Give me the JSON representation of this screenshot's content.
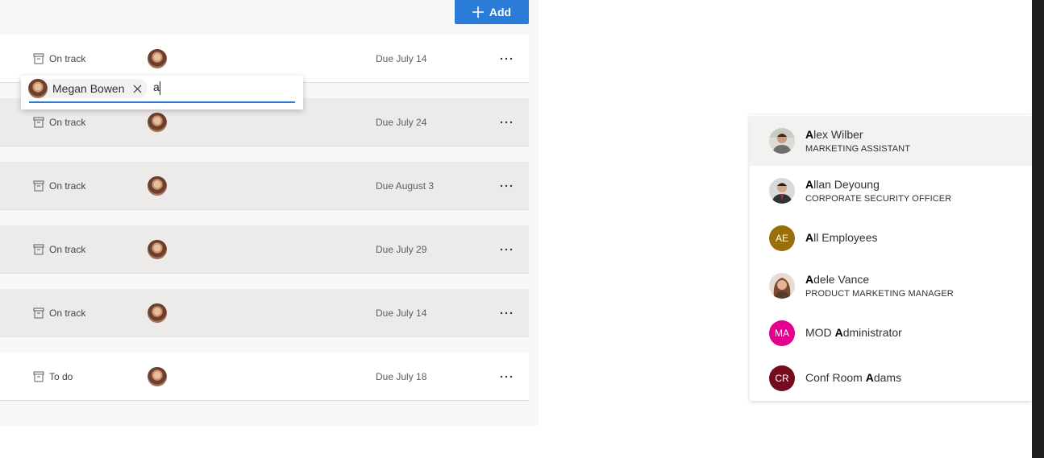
{
  "toolbar": {
    "add_label": "Add",
    "add_icon": "plus-icon"
  },
  "tasks": [
    {
      "status": "On track",
      "status_icon": "archive-icon",
      "due": "Due July 14",
      "bg": "#ffffff"
    },
    {
      "status": "On track",
      "status_icon": "archive-icon",
      "due": "Due July 24",
      "bg": "#edebe9"
    },
    {
      "status": "On track",
      "status_icon": "archive-icon",
      "due": "Due August 3",
      "bg": "#edebe9"
    },
    {
      "status": "On track",
      "status_icon": "archive-icon",
      "due": "Due July 29",
      "bg": "#edebe9"
    },
    {
      "status": "On track",
      "status_icon": "archive-icon",
      "due": "Due July 14",
      "bg": "#edebe9"
    },
    {
      "status": "To do",
      "status_icon": "archive-icon",
      "due": "Due July 18",
      "bg": "#ffffff"
    }
  ],
  "people_picker": {
    "selected_person": "Megan Bowen",
    "query": "a",
    "accent": "#2b7bd8"
  },
  "suggestions": [
    {
      "match": "A",
      "rest": "lex Wilber",
      "title": "MARKETING ASSISTANT",
      "photo": true
    },
    {
      "match": "A",
      "rest": "llan Deyoung",
      "title": "CORPORATE SECURITY OFFICER",
      "photo": true
    },
    {
      "match": "A",
      "rest": "ll Employees",
      "initials": "AE",
      "color": "#986f0b"
    },
    {
      "match": "A",
      "rest": "dele Vance",
      "title": "PRODUCT MARKETING MANAGER",
      "photo": true
    },
    {
      "before": "MOD ",
      "match": "A",
      "rest": "dministrator",
      "initials": "MA",
      "color": "#e3008c"
    },
    {
      "before": "Conf Room ",
      "match": "A",
      "rest": "dams",
      "initials": "CR",
      "color": "#750b1c"
    }
  ]
}
